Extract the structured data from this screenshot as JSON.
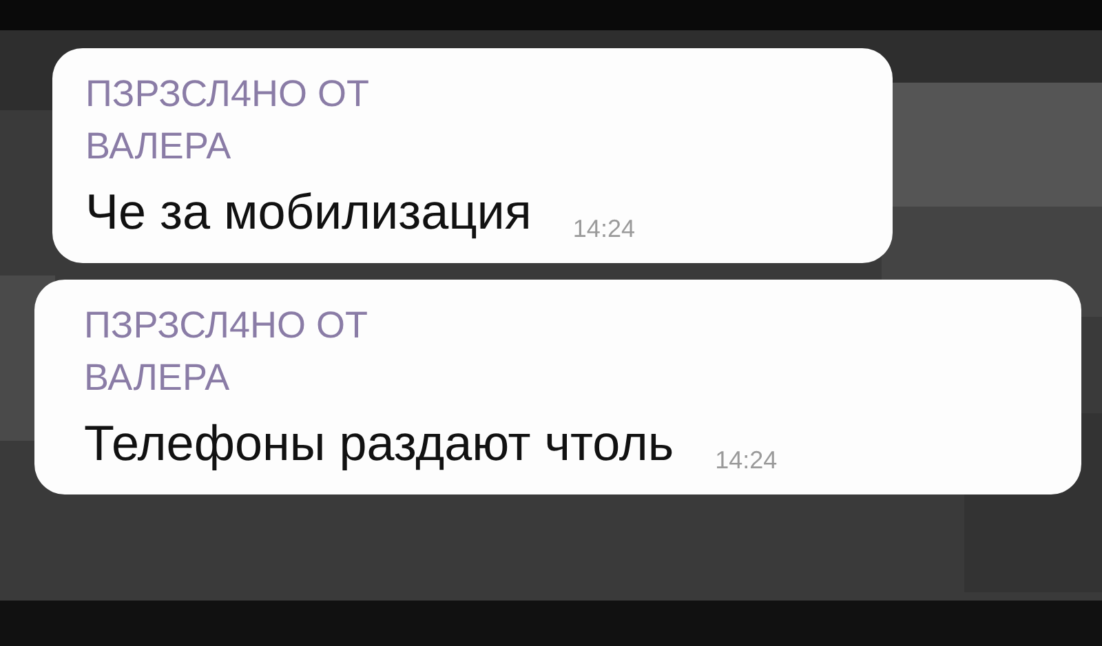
{
  "messages": [
    {
      "forwarded_label": "ПЗРЗСЛ4НО ОТ",
      "sender": "ВАЛЕРА",
      "text": "Че за мобилизация",
      "time": "14:24"
    },
    {
      "forwarded_label": "ПЗРЗСЛ4НО ОТ",
      "sender": "ВАЛЕРА",
      "text": "Телефоны раздают чтоль",
      "time": "14:24"
    }
  ]
}
